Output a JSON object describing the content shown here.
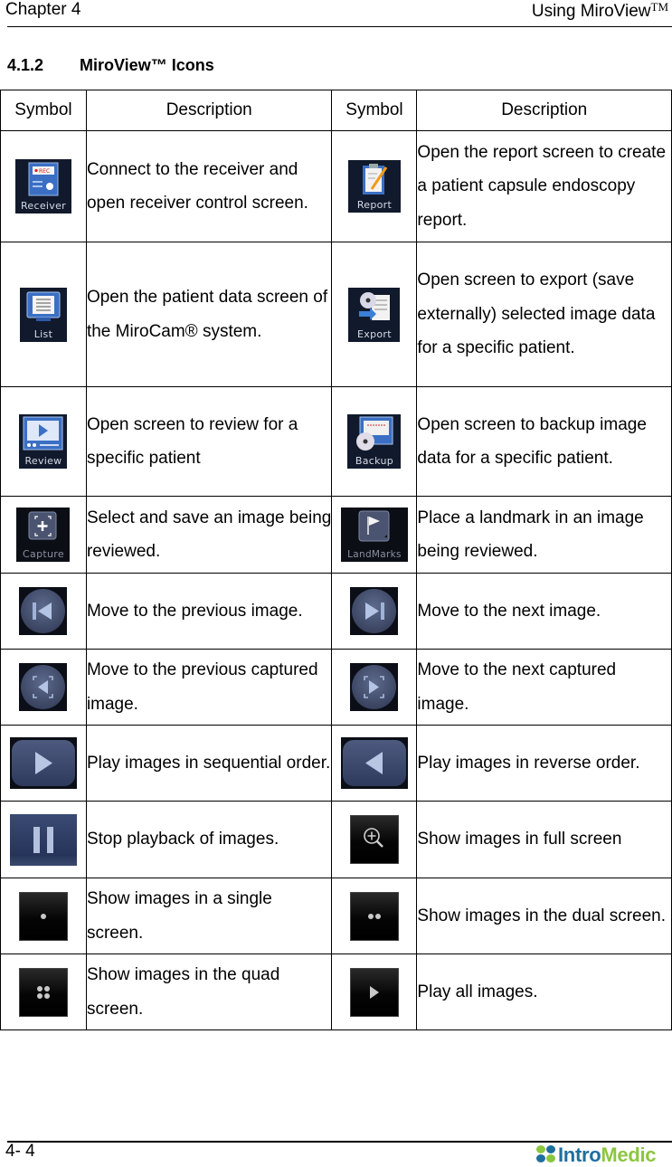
{
  "header": {
    "chapter": "Chapter 4",
    "title": "Using MiroView",
    "title_mark": "TM"
  },
  "section": {
    "number": "4.1.2",
    "title": "MiroView™ Icons"
  },
  "table": {
    "headers": [
      "Symbol",
      "Description",
      "Symbol",
      "Description"
    ],
    "rows": [
      {
        "left": {
          "icon": "receiver-icon",
          "icon_label": "Receiver",
          "description": "Connect to the receiver and open receiver control screen."
        },
        "right": {
          "icon": "report-icon",
          "icon_label": "Report",
          "description": "Open the report screen to create a patient capsule endoscopy report."
        }
      },
      {
        "left": {
          "icon": "list-icon",
          "icon_label": "List",
          "description": "Open the patient data screen of the MiroCam® system."
        },
        "right": {
          "icon": "export-icon",
          "icon_label": "Export",
          "description": "Open screen to export (save externally) selected image data for a specific patient."
        }
      },
      {
        "left": {
          "icon": "review-icon",
          "icon_label": "Review",
          "description": "Open screen to review for a specific patient"
        },
        "right": {
          "icon": "backup-icon",
          "icon_label": "Backup",
          "description": "Open screen to backup image data for a specific patient."
        }
      },
      {
        "left": {
          "icon": "capture-icon",
          "icon_label": "Capture",
          "description": "Select and save an image being reviewed."
        },
        "right": {
          "icon": "landmarks-icon",
          "icon_label": "LandMarks",
          "description": "Place a landmark in an image being reviewed."
        }
      },
      {
        "left": {
          "icon": "previous-image-icon",
          "description": "Move to the previous image."
        },
        "right": {
          "icon": "next-image-icon",
          "description": "Move to the next image."
        }
      },
      {
        "left": {
          "icon": "previous-captured-icon",
          "description": "Move to the previous captured image."
        },
        "right": {
          "icon": "next-captured-icon",
          "description": "Move to the next captured image."
        }
      },
      {
        "left": {
          "icon": "play-forward-icon",
          "description": "Play images in sequential order."
        },
        "right": {
          "icon": "play-reverse-icon",
          "description": "Play images in reverse order."
        }
      },
      {
        "left": {
          "icon": "pause-icon",
          "description": "Stop playback of images."
        },
        "right": {
          "icon": "zoom-in-icon",
          "description": "Show images in full screen"
        }
      },
      {
        "left": {
          "icon": "single-screen-icon",
          "description": "Show images in a single screen."
        },
        "right": {
          "icon": "dual-screen-icon",
          "description": "Show images in the dual screen."
        }
      },
      {
        "left": {
          "icon": "quad-screen-icon",
          "description": "Show images in the quad screen."
        },
        "right": {
          "icon": "play-all-icon",
          "description": "Play all images."
        }
      }
    ]
  },
  "footer": {
    "page_number": "4- 4",
    "logo_part1": "Intro",
    "logo_part2": "Medic"
  },
  "colors": {
    "logo_blue": "#1f6f9e",
    "logo_green": "#8cc63f",
    "icon_bg": "#111a2c",
    "icon_blue": "#3a6fc4"
  }
}
